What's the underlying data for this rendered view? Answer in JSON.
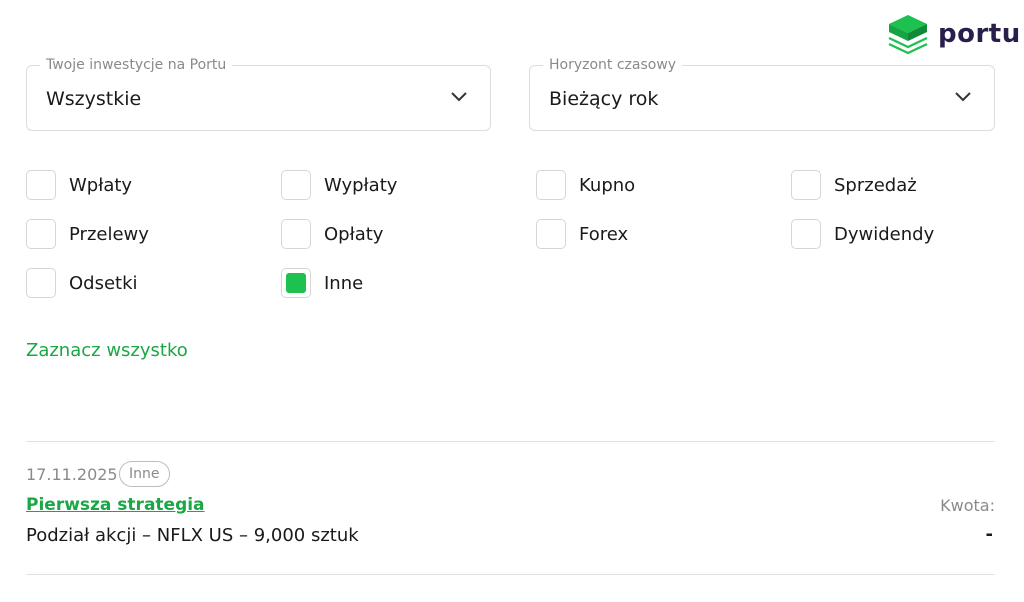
{
  "brand": {
    "name": "portu",
    "accent": "#1cc14f",
    "link_color": "#1aa746",
    "logo_icon": "stacked-layers-icon"
  },
  "filters_top": {
    "investments": {
      "legend": "Twoje inwestycje na Portu",
      "value": "Wszystkie"
    },
    "horizon": {
      "legend": "Horyzont czasowy",
      "value": "Bieżący rok"
    }
  },
  "transaction_types": [
    {
      "label": "Wpłaty",
      "checked": false
    },
    {
      "label": "Wypłaty",
      "checked": false
    },
    {
      "label": "Kupno",
      "checked": false
    },
    {
      "label": "Sprzedaż",
      "checked": false
    },
    {
      "label": "Przelewy",
      "checked": false
    },
    {
      "label": "Opłaty",
      "checked": false
    },
    {
      "label": "Forex",
      "checked": false
    },
    {
      "label": "Dywidendy",
      "checked": false
    },
    {
      "label": "Odsetki",
      "checked": false
    },
    {
      "label": "Inne",
      "checked": true
    }
  ],
  "select_all_label": "Zaznacz wszystko",
  "transactions": [
    {
      "date": "17.11.2025",
      "tag": "Inne",
      "strategy": "Pierwsza strategia",
      "description": "Podział akcji – NFLX US –  9,000 sztuk",
      "amount_label": "Kwota:",
      "amount_value": "-"
    }
  ]
}
